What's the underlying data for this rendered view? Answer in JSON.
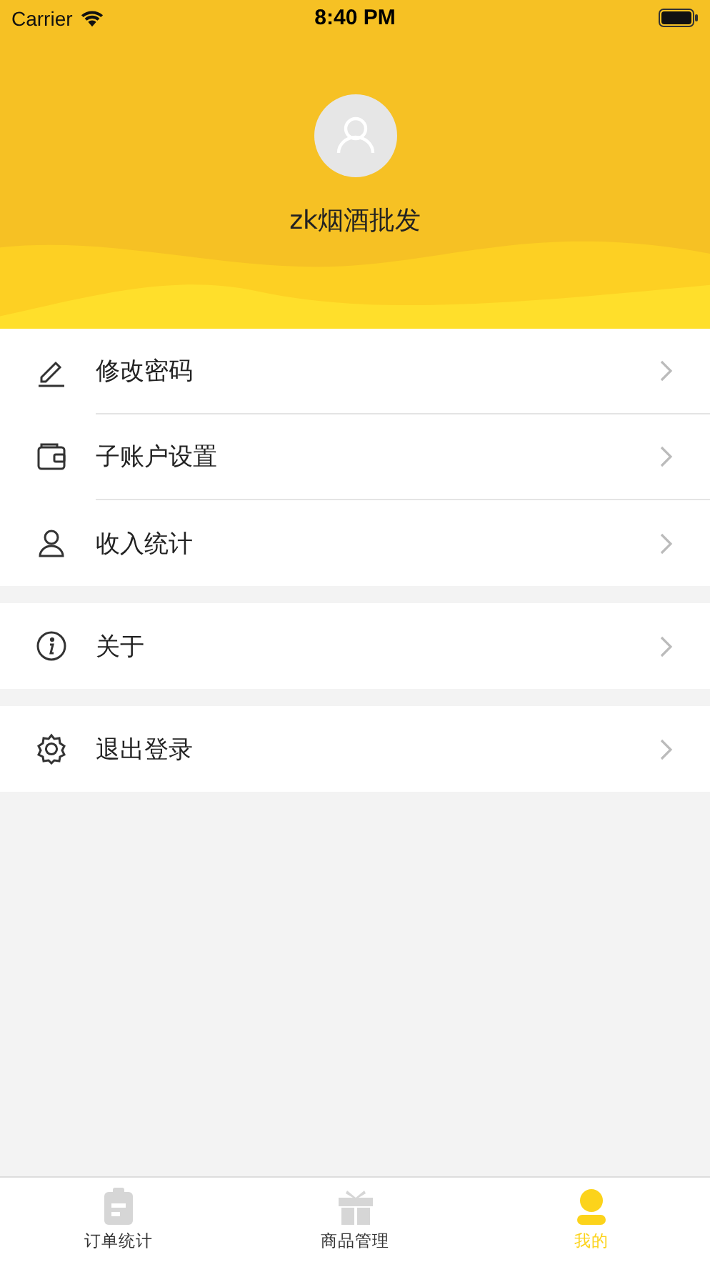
{
  "status_bar": {
    "carrier": "Carrier",
    "time": "8:40 PM"
  },
  "profile": {
    "name": "zk烟酒批发"
  },
  "menu_groups": [
    {
      "items": [
        {
          "label": "修改密码",
          "kind": "pencil"
        },
        {
          "label": "子账户设置",
          "kind": "wallet"
        },
        {
          "label": "收入统计",
          "kind": "person"
        }
      ]
    },
    {
      "items": [
        {
          "label": "关于",
          "kind": "info"
        }
      ]
    },
    {
      "items": [
        {
          "label": "退出登录",
          "kind": "gear"
        }
      ]
    }
  ],
  "tabs": [
    {
      "label": "订单统计",
      "kind": "clipboard",
      "selected": false
    },
    {
      "label": "商品管理",
      "kind": "gift",
      "selected": false
    },
    {
      "label": "我的",
      "kind": "person",
      "selected": true
    }
  ]
}
